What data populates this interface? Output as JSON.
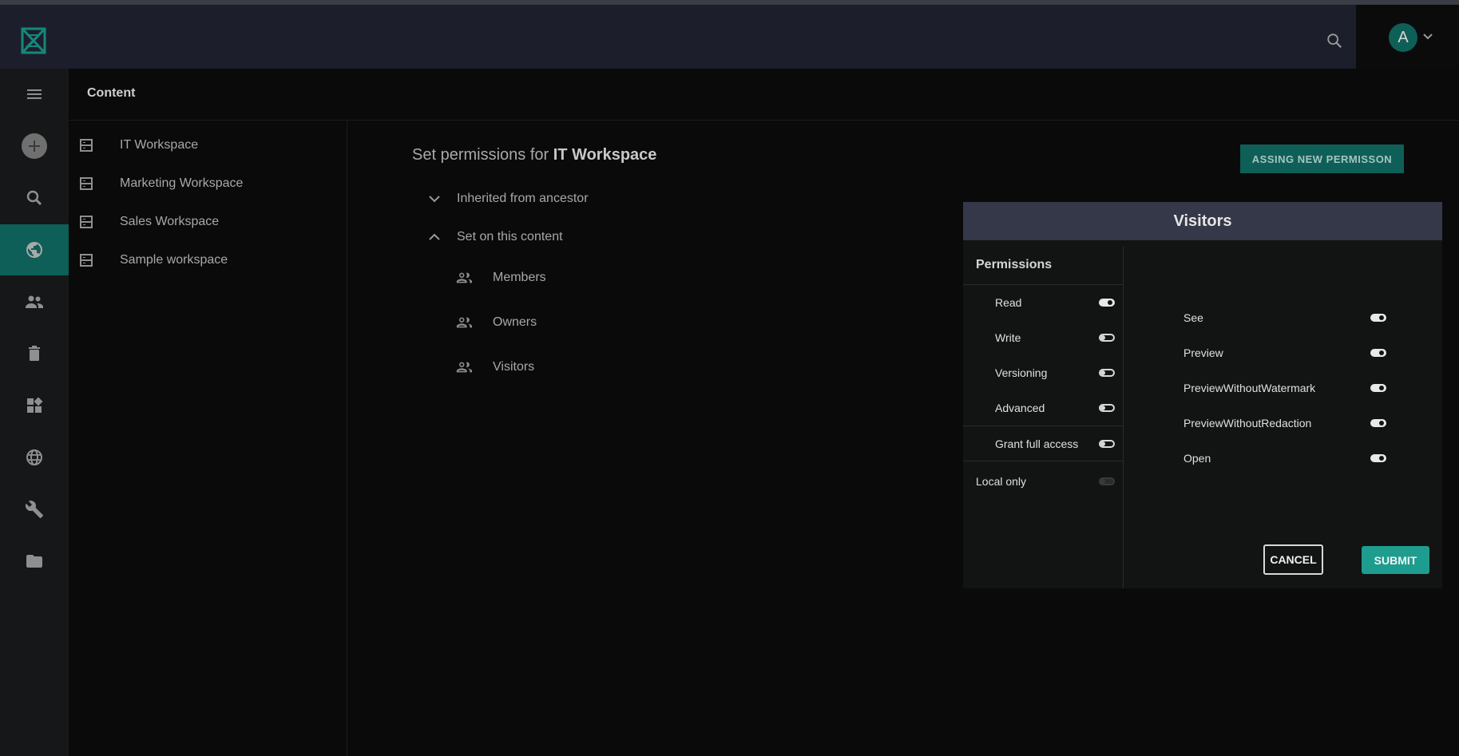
{
  "header": {
    "logo_icon": "logo-mark-icon",
    "search_icon": "search-icon",
    "avatar_initial": "A"
  },
  "sidebar": {
    "items": [
      {
        "name": "menu",
        "icon": "hamburger-icon"
      },
      {
        "name": "add",
        "icon": "plus-icon"
      },
      {
        "name": "search",
        "icon": "search-icon"
      },
      {
        "name": "content",
        "icon": "globe-icon",
        "active": true
      },
      {
        "name": "users",
        "icon": "people-icon"
      },
      {
        "name": "trash",
        "icon": "trash-icon"
      },
      {
        "name": "apps",
        "icon": "widgets-icon"
      },
      {
        "name": "localization",
        "icon": "language-icon"
      },
      {
        "name": "setup",
        "icon": "wrench-icon"
      },
      {
        "name": "files",
        "icon": "folder-icon"
      }
    ]
  },
  "breadcrumb": "Content",
  "workspaces": [
    {
      "label": "IT Workspace"
    },
    {
      "label": "Marketing Workspace"
    },
    {
      "label": "Sales Workspace"
    },
    {
      "label": "Sample workspace"
    }
  ],
  "permissions_page": {
    "title_prefix": "Set permissions for ",
    "title_target": "IT Workspace",
    "inherited_label": "Inherited from ancestor",
    "set_on_label": "Set on this content",
    "groups": [
      {
        "label": "Members"
      },
      {
        "label": "Owners"
      },
      {
        "label": "Visitors"
      }
    ],
    "assign_button": "ASSING NEW PERMISSON"
  },
  "dialog": {
    "title": "Visitors",
    "permissions_heading": "Permissions",
    "left_options": [
      {
        "label": "Read",
        "on": true
      },
      {
        "label": "Write",
        "on": false
      },
      {
        "label": "Versioning",
        "on": false
      },
      {
        "label": "Advanced",
        "on": false
      }
    ],
    "grant_full_access": {
      "label": "Grant full access",
      "on": false
    },
    "local_only": {
      "label": "Local only",
      "disabled": true
    },
    "right_options": [
      {
        "label": "See",
        "on": true
      },
      {
        "label": "Preview",
        "on": true
      },
      {
        "label": "PreviewWithoutWatermark",
        "on": true
      },
      {
        "label": "PreviewWithoutRedaction",
        "on": true
      },
      {
        "label": "Open",
        "on": true
      }
    ],
    "cancel_label": "CANCEL",
    "submit_label": "SUBMIT"
  },
  "colors": {
    "accent": "#0e5f57",
    "submit": "#1e9d8f",
    "topbar": "#1c1f2b",
    "dialog_header": "#343848"
  }
}
